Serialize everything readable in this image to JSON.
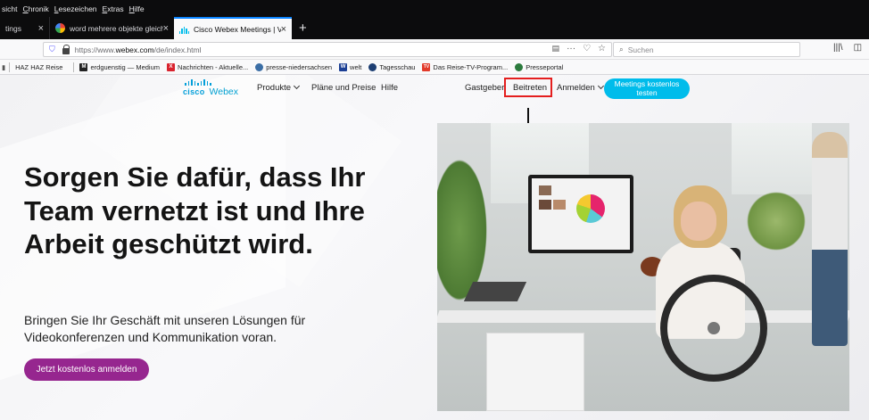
{
  "browser": {
    "menu": [
      {
        "pre": "",
        "u": "",
        "post": "sicht"
      },
      {
        "pre": "",
        "u": "C",
        "post": "hronik"
      },
      {
        "pre": "",
        "u": "L",
        "post": "esezeichen"
      },
      {
        "pre": "",
        "u": "E",
        "post": "xtras"
      },
      {
        "pre": "",
        "u": "H",
        "post": "ilfe"
      }
    ],
    "tabs": [
      {
        "title": "tings"
      },
      {
        "title": "word mehrere objekte gleichze"
      },
      {
        "title": "Cisco Webex Meetings | Videok"
      }
    ],
    "tab_close": "×",
    "new_tab": "+",
    "url_scheme": "https://www.",
    "url_host": "webex.com",
    "url_path": "/de/index.html",
    "url_actions": [
      "···",
      "♡",
      "☆"
    ],
    "search_placeholder": "Suchen",
    "bookmarks": [
      {
        "label": "HAZ HAZ Reise",
        "icon_text": "",
        "color": "#ffffff"
      },
      {
        "label": "erdguenstig — Medium",
        "icon_text": "M",
        "color": "#222222"
      },
      {
        "label": "Nachrichten - Aktuelle...",
        "icon_text": "X",
        "color": "#d9232e"
      },
      {
        "label": "presse-niedersachsen",
        "icon_text": "",
        "color": "#3b6ea5"
      },
      {
        "label": "welt",
        "icon_text": "W",
        "color": "#1c3f94"
      },
      {
        "label": "Tagesschau",
        "icon_text": "",
        "color": "#1d3f73"
      },
      {
        "label": "Das Reise-TV-Program...",
        "icon_text": "TV",
        "color": "#e23a2a"
      },
      {
        "label": "Presseportal",
        "icon_text": "",
        "color": "#2b7a3d"
      }
    ]
  },
  "site": {
    "logo_cisco": "cisco",
    "logo_webex": "Webex",
    "nav": {
      "produkte": "Produkte",
      "plaene": "Pläne und Preise",
      "hilfe": "Hilfe",
      "gastgeber": "Gastgeber",
      "beitreten": "Beitreten",
      "anmelden": "Anmelden"
    },
    "cta_top": "Meetings kostenlos testen",
    "hero": {
      "title": "Sorgen Sie dafür, dass Ihr Team vernetzt ist und Ihre Arbeit geschützt wird.",
      "subtitle": "Bringen Sie Ihr Geschäft mit unseren Lösungen für Videokonferenzen und Kommunikation voran.",
      "cta": "Jetzt kostenlos anmelden"
    }
  },
  "colors": {
    "cisco_blue": "#049fd9",
    "cta_cyan": "#00bceb",
    "cta_purple": "#96268f",
    "highlight_red": "#e41e1e"
  }
}
